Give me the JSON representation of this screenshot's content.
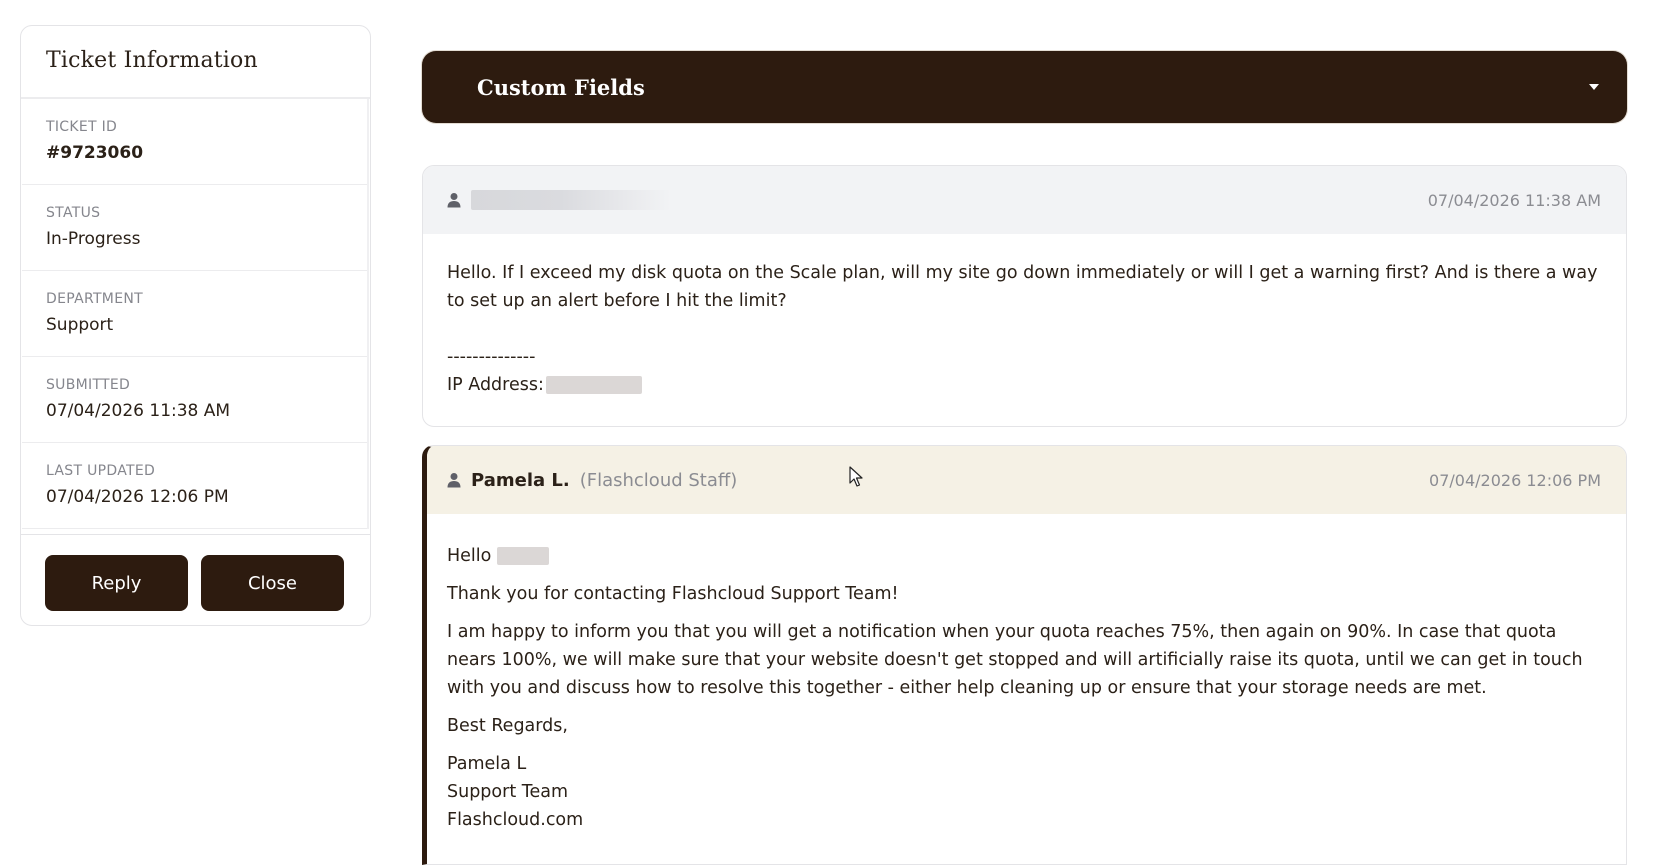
{
  "sidebar": {
    "title": "Ticket Information",
    "fields": [
      {
        "label": "TICKET ID",
        "value": "#9723060"
      },
      {
        "label": "STATUS",
        "value": "In-Progress"
      },
      {
        "label": "DEPARTMENT",
        "value": "Support"
      },
      {
        "label": "SUBMITTED",
        "value": "07/04/2026 11:38 AM"
      },
      {
        "label": "LAST UPDATED",
        "value": "07/04/2026 12:06 PM"
      }
    ],
    "reply_label": "Reply",
    "close_label": "Close"
  },
  "custom_fields": {
    "title": "Custom Fields",
    "icon": "chevron-down-icon"
  },
  "messages": [
    {
      "date": "07/04/2026 11:38 AM",
      "body": "Hello. If I exceed my disk quota on the Scale plan, will my site go down immediately or will I get a warning first? And is there a way to set up an alert before I hit the limit?",
      "separator": "--------------",
      "ip_label": "IP Address:"
    },
    {
      "author": "Pamela L.",
      "role": "(Flashcloud Staff)",
      "date": "07/04/2026 12:06 PM",
      "greeting": "Hello",
      "paragraphs": [
        "Thank you for contacting Flashcloud Support Team!",
        "I am happy to inform you that you will get a notification when your quota reaches 75%, then again on 90%. In case that quota nears 100%, we will make sure that your website doesn't get stopped and will artificially raise its quota, until we can get in touch with you and discuss how to resolve this together - either help cleaning up or ensure that your storage needs are met.",
        "Best Regards,"
      ],
      "signature": [
        "Pamela L",
        "Support Team",
        "Flashcloud.com"
      ]
    }
  ],
  "colors": {
    "brand_dark": "#2d1b0f",
    "staff_header_bg": "#f5f1e5",
    "client_header_bg": "#f2f3f5"
  }
}
